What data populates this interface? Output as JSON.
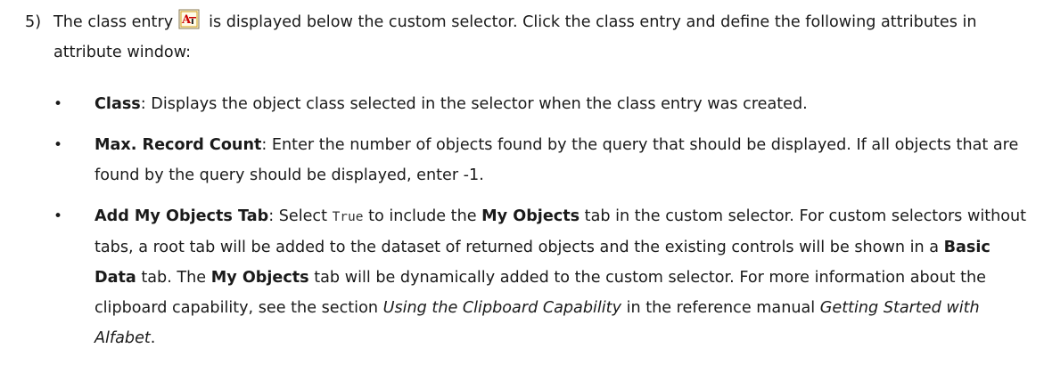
{
  "step": {
    "number": "5)",
    "text_before_icon": "The class entry",
    "icon": "class-entry-icon",
    "text_after_icon": "is displayed below the custom selector. Click the class entry and define the following attributes in attribute window:"
  },
  "bullets": [
    {
      "term": "Class",
      "desc": ": Displays the object class selected in the selector when the class entry was created."
    },
    {
      "term": "Max. Record Count",
      "desc": ": Enter the number of objects found by the query that should be displayed. If all objects that are found by the query should be displayed, enter -1."
    },
    {
      "term": "Add My Objects Tab",
      "p1": ": Select ",
      "code": "True",
      "p2": " to include the ",
      "b1": "My Objects",
      "p3": " tab in the custom selector. For custom selectors without tabs, a root tab will be added to the dataset of returned objects and the existing controls will be shown in a ",
      "b2": "Basic Data",
      "p4": " tab. The ",
      "b3": "My Objects",
      "p5": " tab will be dynamically added to the custom selector. For more information about the clipboard capability, see the section ",
      "i1": "Using the Clipboard Capability",
      "p6": " in the reference manual ",
      "i2": "Getting Started with Alfabet",
      "p7": "."
    }
  ],
  "colors": {
    "text": "#1a1a1a",
    "icon_red": "#cc0000",
    "icon_gold": "#d4a017"
  }
}
